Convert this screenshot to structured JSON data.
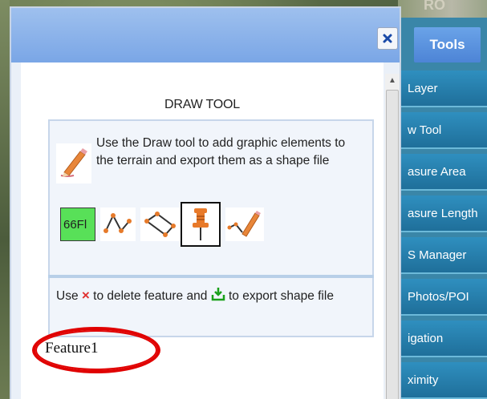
{
  "map": {
    "overlay_text": "RO"
  },
  "tools_menu": {
    "button_label": "Tools",
    "items": [
      {
        "label": "Layer"
      },
      {
        "label": "w Tool"
      },
      {
        "label": "asure Area"
      },
      {
        "label": "asure Length"
      },
      {
        "label": "S Manager"
      },
      {
        "label": "Photos/POI"
      },
      {
        "label": "igation"
      },
      {
        "label": "ximity"
      }
    ]
  },
  "dialog": {
    "close_label": "×",
    "title": "DRAW TOOL",
    "description": "Use the Draw tool to add graphic elements to the terrain and export them as a shape file",
    "tools": [
      {
        "icon": "text-tool-icon",
        "label": "66Fl"
      },
      {
        "icon": "polyline-tool-icon"
      },
      {
        "icon": "polygon-tool-icon"
      },
      {
        "icon": "pushpin-tool-icon",
        "selected": true
      },
      {
        "icon": "freehand-line-tool-icon"
      }
    ],
    "help": {
      "prefix": "Use",
      "middle": "to delete feature and",
      "suffix": "to export shape file",
      "delete_icon": "×"
    },
    "features": [
      {
        "name": "Feature1"
      }
    ]
  },
  "colors": {
    "header_blue": "#7aa6e6",
    "menu_blue": "#2f8fbf",
    "highlight_red": "#e00000",
    "text_tool_green": "#58e058"
  }
}
